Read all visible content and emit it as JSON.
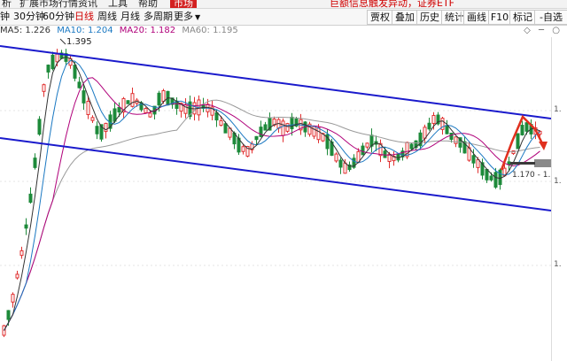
{
  "menubar": {
    "items": [
      "析",
      "扩展市场行情",
      "资讯",
      "工具",
      "帮助",
      "市场"
    ],
    "notice": "巨额信息触发异动，证券ETF"
  },
  "toolbar": {
    "periods": [
      "钟",
      "30分钟",
      "60分钟",
      "日线",
      "周线",
      "月线",
      "多周期",
      "更多"
    ],
    "active_period": "日线",
    "buttons": [
      "贾权",
      "叠加",
      "历史",
      "统计",
      "画线",
      "F10",
      "标记",
      "自选"
    ]
  },
  "ma": {
    "ma5": "MA5: 1.226",
    "ma10": "MA10: 1.204",
    "ma20": "MA20: 1.182",
    "ma60": "MA60: 1.195",
    "colors": {
      "ma5": "#333333",
      "ma10": "#1a78c2",
      "ma20": "#b0007a",
      "ma60": "#999999"
    }
  },
  "chart": {
    "high_label": "1.395",
    "low_label": "1.170 - 1.1",
    "axis_labels": [
      "1.",
      "1.",
      "1."
    ]
  },
  "icons": [
    "expand-icon",
    "minimize-icon",
    "close-icon"
  ]
}
